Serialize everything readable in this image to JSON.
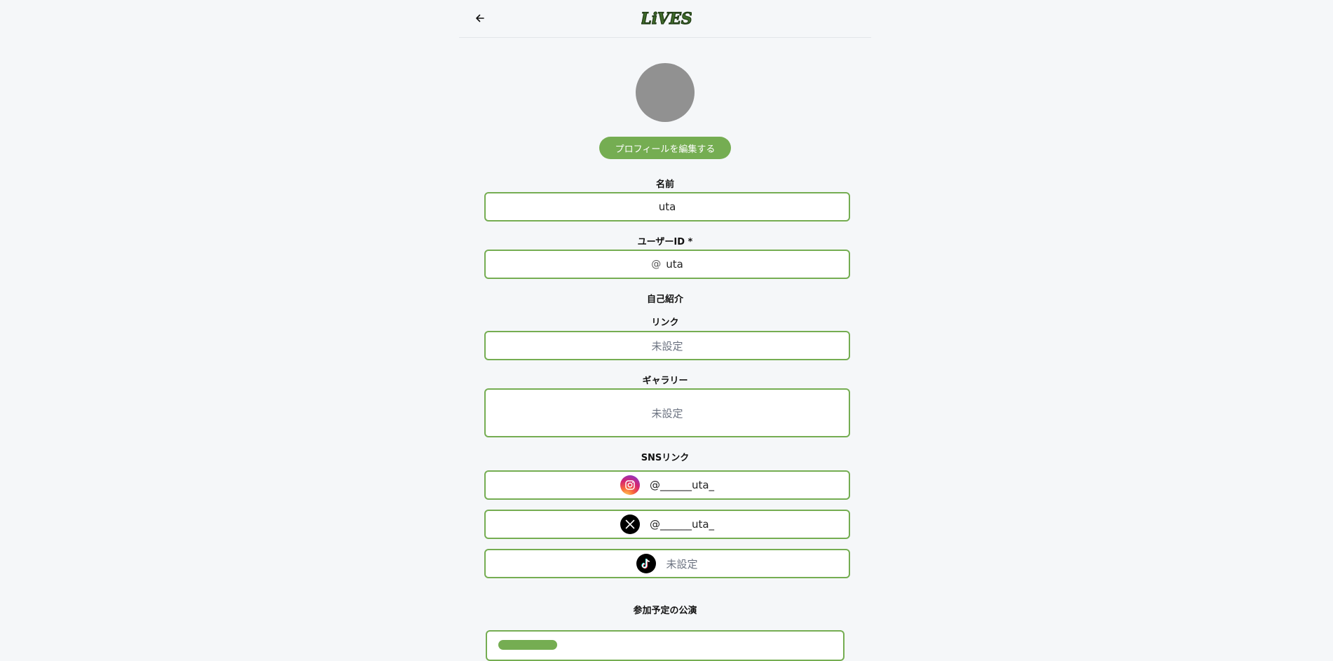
{
  "header": {
    "back_icon": "arrow-left-icon",
    "logo_text": "LiVES"
  },
  "profile": {
    "edit_button": "プロフィールを編集する"
  },
  "fields": {
    "name_label": "名前",
    "name_value": "uta",
    "user_id_label": "ユーザーID *",
    "user_id_prefix": "@",
    "user_id_value": "uta",
    "bio_label": "自己紹介",
    "link_label": "リンク",
    "link_placeholder": "未設定",
    "gallery_label": "ギャラリー",
    "gallery_placeholder": "未設定"
  },
  "sns": {
    "label": "SNSリンク",
    "items": [
      {
        "icon": "instagram-icon",
        "value": "@______uta_"
      },
      {
        "icon": "x-icon",
        "value": "@______uta_"
      },
      {
        "icon": "tiktok-icon",
        "value": "未設定"
      }
    ]
  },
  "events": {
    "label": "参加予定の公演"
  },
  "colors": {
    "accent": "#75ad52",
    "background": "#f5f7f9",
    "avatar": "#919191"
  }
}
